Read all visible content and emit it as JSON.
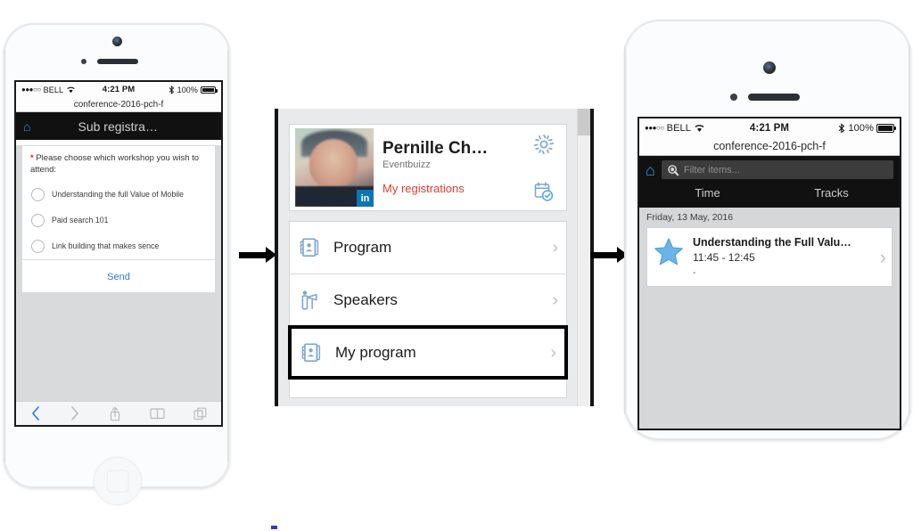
{
  "meta": {
    "title": "Eventbuizz mobile app sub-registration flow"
  },
  "status_bar": {
    "signal_dots": "●●●○○",
    "carrier": "BELL",
    "wifi_icon": "wifi-icon",
    "time": "4:21 PM",
    "bluetooth_icon": "bluetooth-icon",
    "battery_percent": "100%"
  },
  "url_bar": {
    "url": "conference-2016-pch-f"
  },
  "phone1": {
    "header": {
      "home_icon": "home-icon",
      "title": "Sub registra…"
    },
    "form": {
      "required_marker": "*",
      "question": "Please choose which workshop you wish to attend:",
      "options": [
        {
          "label": "Understanding the full Value of Mobile",
          "selected": false
        },
        {
          "label": "Paid search 101",
          "selected": false
        },
        {
          "label": "Link building that makes sence",
          "selected": false
        }
      ],
      "submit_label": "Send"
    },
    "safari_toolbar": {
      "back_icon": "back-chevron-icon",
      "forward_icon": "forward-chevron-icon",
      "share_icon": "share-icon",
      "bookmarks_icon": "book-icon",
      "tabs_icon": "tabs-icon"
    }
  },
  "phone2": {
    "profile": {
      "avatar": "profile-photo",
      "linkedin_badge": "in",
      "name": "Pernille Ch…",
      "organization": "Eventbuizz",
      "registrations_link": "My registrations",
      "settings_icon": "gear-icon",
      "registrations_icon": "calendar-check-icon"
    },
    "menu": [
      {
        "label": "Program",
        "icon": "program-card-icon",
        "selected": false
      },
      {
        "label": "Speakers",
        "icon": "speaker-podium-icon",
        "selected": false
      },
      {
        "label": "My program",
        "icon": "program-card-icon",
        "selected": true
      }
    ],
    "chevron_icon": "chevron-right-icon",
    "scrollbar": "vertical-scrollbar"
  },
  "phone3": {
    "header": {
      "home_icon": "home-icon",
      "search_icon": "search-icon",
      "filter_placeholder": "Filter items...",
      "filter_value": ""
    },
    "tabs": [
      {
        "label": "Time",
        "active": true
      },
      {
        "label": "Tracks",
        "active": false
      }
    ],
    "day_label": "Friday, 13 May, 2016",
    "sessions": [
      {
        "favorite_icon": "star-icon",
        "title": "Understanding the Full Valu…",
        "time": "11:45 - 12:45",
        "subtitle": "-",
        "chevron_icon": "chevron-right-icon"
      }
    ]
  },
  "flow": {
    "arrow1": "arrow-right-icon",
    "arrow2": "arrow-right-icon"
  },
  "colors": {
    "accent_blue": "#2a9fe8",
    "link_blue": "#2a7bdd",
    "alert_red": "#e23b2e",
    "header_black": "#111111",
    "icon_blue": "#7ba7cf",
    "star_blue": "#6ab4e8"
  }
}
